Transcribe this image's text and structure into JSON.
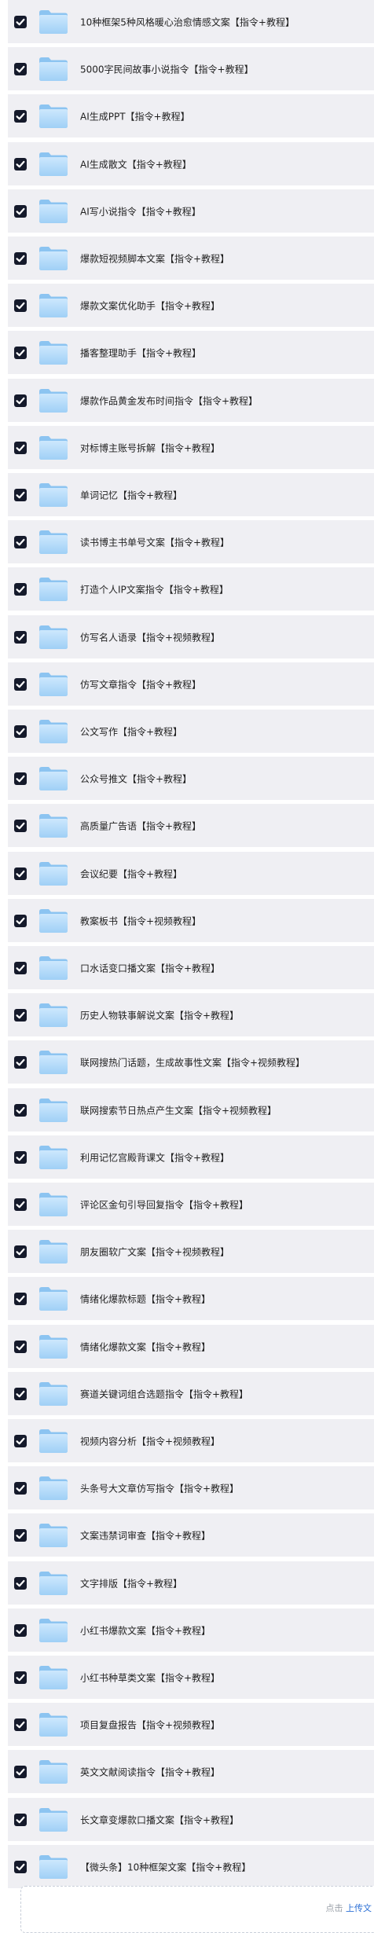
{
  "items": [
    {
      "label": "10种框架5种风格暖心治愈情感文案【指令+教程】"
    },
    {
      "label": "5000字民间故事小说指令【指令+教程】"
    },
    {
      "label": "AI生成PPT【指令+教程】"
    },
    {
      "label": "AI生成散文【指令+教程】"
    },
    {
      "label": "AI写小说指令【指令+教程】"
    },
    {
      "label": "爆款短视频脚本文案【指令+教程】"
    },
    {
      "label": "爆款文案优化助手【指令+教程】"
    },
    {
      "label": "播客整理助手【指令+教程】"
    },
    {
      "label": "爆款作品黄金发布时间指令【指令+教程】"
    },
    {
      "label": "对标博主账号拆解【指令+教程】"
    },
    {
      "label": "单词记忆【指令+教程】"
    },
    {
      "label": "读书博主书单号文案【指令+教程】"
    },
    {
      "label": "打造个人IP文案指令【指令+教程】"
    },
    {
      "label": "仿写名人语录【指令+视频教程】"
    },
    {
      "label": "仿写文章指令【指令+教程】"
    },
    {
      "label": "公文写作【指令+教程】"
    },
    {
      "label": "公众号推文【指令+教程】"
    },
    {
      "label": "高质量广告语【指令+教程】"
    },
    {
      "label": "会议纪要【指令+教程】"
    },
    {
      "label": "教案板书【指令+视频教程】"
    },
    {
      "label": "口水话变口播文案【指令+教程】"
    },
    {
      "label": "历史人物轶事解说文案【指令+教程】"
    },
    {
      "label": "联网搜热门话题，生成故事性文案【指令+视频教程】"
    },
    {
      "label": "联网搜索节日热点产生文案【指令+视频教程】"
    },
    {
      "label": "利用记忆宫殿背课文【指令+教程】"
    },
    {
      "label": "评论区金句引导回复指令【指令+教程】"
    },
    {
      "label": "朋友圈软广文案【指令+视频教程】"
    },
    {
      "label": "情绪化爆款标题【指令+教程】"
    },
    {
      "label": "情绪化爆款文案【指令+教程】"
    },
    {
      "label": "赛道关键词组合选题指令【指令+教程】"
    },
    {
      "label": "视频内容分析【指令+视频教程】"
    },
    {
      "label": "头条号大文章仿写指令【指令+教程】"
    },
    {
      "label": "文案违禁词审查【指令+教程】"
    },
    {
      "label": "文字排版【指令+教程】"
    },
    {
      "label": "小红书爆款文案【指令+教程】"
    },
    {
      "label": "小红书种草类文案【指令+教程】"
    },
    {
      "label": "项目复盘报告【指令+视频教程】"
    },
    {
      "label": "英文文献阅读指令【指令+教程】"
    },
    {
      "label": "长文章变爆款口播文案【指令+教程】"
    },
    {
      "label": "【微头条】10种框架文案【指令+教程】"
    }
  ],
  "icons": {
    "checkbox": "checkbox-checked-icon",
    "folder": "folder-icon"
  },
  "colors": {
    "row_bg": "#efeff3",
    "checkbox_bg": "#151a2b",
    "folder_light": "#bfe0fb",
    "folder_dark": "#8cc4f1",
    "link": "#2b6fd6"
  },
  "footer": {
    "hint_prefix": "点击",
    "hint_link": "上传文"
  }
}
